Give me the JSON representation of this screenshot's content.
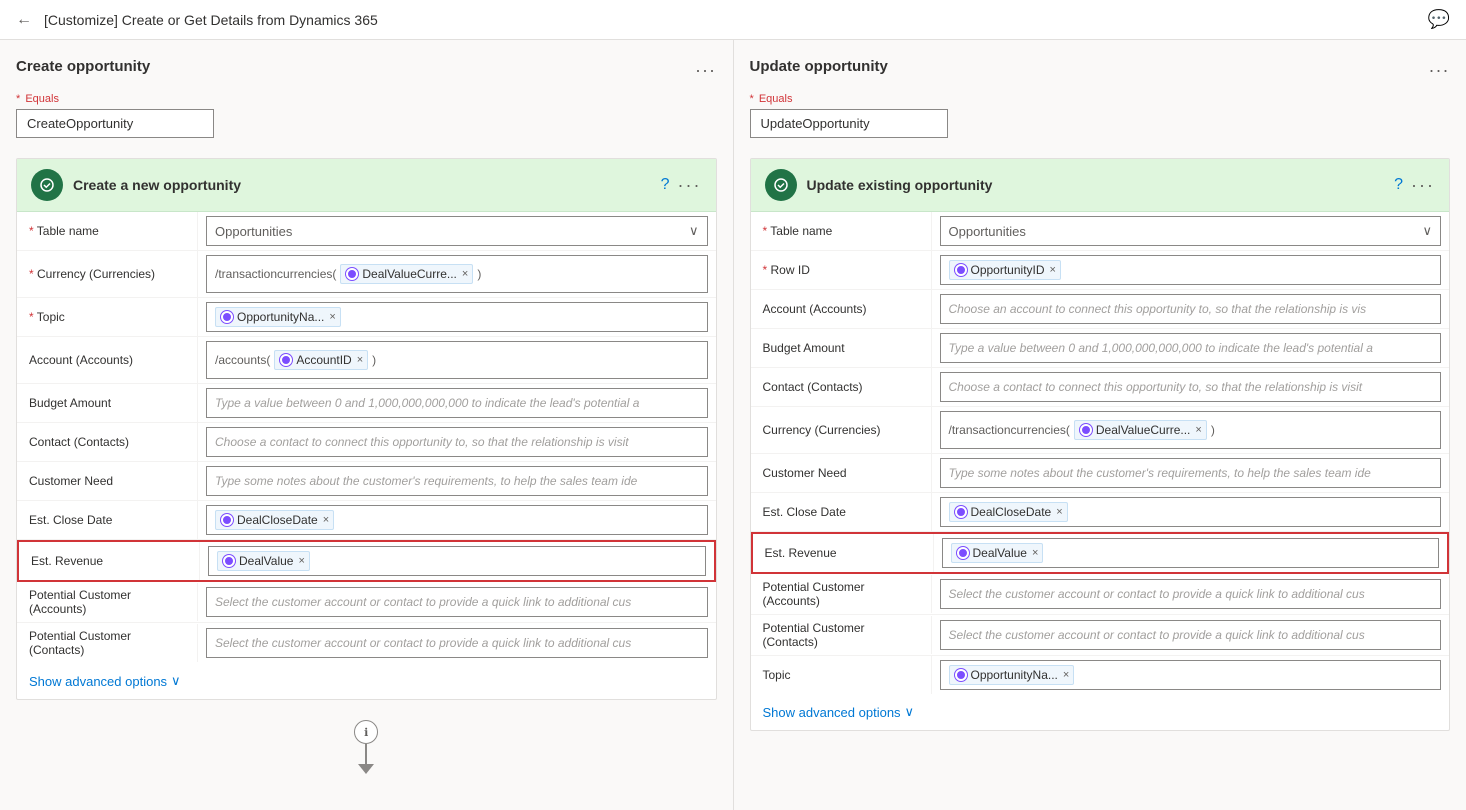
{
  "topbar": {
    "back_icon": "←",
    "title": "[Customize] Create or Get Details from Dynamics 365",
    "chat_icon": "💬"
  },
  "left_panel": {
    "header": {
      "title": "Create opportunity",
      "menu": "..."
    },
    "equals": {
      "label": "Equals",
      "required": true,
      "value": "CreateOpportunity"
    },
    "action_card": {
      "title": "Create a new opportunity",
      "help_icon": "?",
      "more_icon": "..."
    },
    "fields": [
      {
        "label": "Table name",
        "required": true,
        "type": "dropdown",
        "value": "Opportunities"
      },
      {
        "label": "Currency (Currencies)",
        "required": true,
        "type": "mixed",
        "prefix": "/transactioncurrencies(",
        "token": "DealValueCurre...",
        "suffix": ")"
      },
      {
        "label": "Topic",
        "required": true,
        "type": "token",
        "token": "OpportunityNa..."
      },
      {
        "label": "Account (Accounts)",
        "required": false,
        "type": "mixed",
        "prefix": "/accounts(",
        "token": "AccountID",
        "suffix": ")"
      },
      {
        "label": "Budget Amount",
        "required": false,
        "type": "placeholder",
        "placeholder": "Type a value between 0 and 1,000,000,000,000 to indicate the lead's potential a"
      },
      {
        "label": "Contact (Contacts)",
        "required": false,
        "type": "placeholder",
        "placeholder": "Choose a contact to connect this opportunity to, so that the relationship is visit"
      },
      {
        "label": "Customer Need",
        "required": false,
        "type": "placeholder",
        "placeholder": "Type some notes about the customer's requirements, to help the sales team ide"
      },
      {
        "label": "Est. Close Date",
        "required": false,
        "type": "token",
        "token": "DealCloseDate"
      },
      {
        "label": "Est. Revenue",
        "required": false,
        "type": "token",
        "token": "DealValue",
        "highlighted": true
      },
      {
        "label": "Potential Customer (Accounts)",
        "required": false,
        "type": "placeholder",
        "placeholder": "Select the customer account or contact to provide a quick link to additional cus"
      },
      {
        "label": "Potential Customer (Contacts)",
        "required": false,
        "type": "placeholder",
        "placeholder": "Select the customer account or contact to provide a quick link to additional cus"
      }
    ],
    "advanced_options": "Show advanced options",
    "advanced_chevron": "∨"
  },
  "right_panel": {
    "header": {
      "title": "Update opportunity",
      "menu": "..."
    },
    "equals": {
      "label": "Equals",
      "required": true,
      "value": "UpdateOpportunity"
    },
    "action_card": {
      "title": "Update existing opportunity",
      "help_icon": "?",
      "more_icon": "..."
    },
    "fields": [
      {
        "label": "Table name",
        "required": true,
        "type": "dropdown",
        "value": "Opportunities"
      },
      {
        "label": "Row ID",
        "required": true,
        "type": "token",
        "token": "OpportunityID"
      },
      {
        "label": "Account (Accounts)",
        "required": false,
        "type": "placeholder",
        "placeholder": "Choose an account to connect this opportunity to, so that the relationship is vis"
      },
      {
        "label": "Budget Amount",
        "required": false,
        "type": "placeholder",
        "placeholder": "Type a value between 0 and 1,000,000,000,000 to indicate the lead's potential a"
      },
      {
        "label": "Contact (Contacts)",
        "required": false,
        "type": "placeholder",
        "placeholder": "Choose a contact to connect this opportunity to, so that the relationship is visit"
      },
      {
        "label": "Currency (Currencies)",
        "required": false,
        "type": "mixed",
        "prefix": "/transactioncurrencies(",
        "token": "DealValueCurre...",
        "suffix": ")"
      },
      {
        "label": "Customer Need",
        "required": false,
        "type": "placeholder",
        "placeholder": "Type some notes about the customer's requirements, to help the sales team ide"
      },
      {
        "label": "Est. Close Date",
        "required": false,
        "type": "token",
        "token": "DealCloseDate"
      },
      {
        "label": "Est. Revenue",
        "required": false,
        "type": "token",
        "token": "DealValue",
        "highlighted": true
      },
      {
        "label": "Potential Customer (Accounts)",
        "required": false,
        "type": "placeholder",
        "placeholder": "Select the customer account or contact to provide a quick link to additional cus"
      },
      {
        "label": "Potential Customer (Contacts)",
        "required": false,
        "type": "placeholder",
        "placeholder": "Select the customer account or contact to provide a quick link to additional cus"
      },
      {
        "label": "Topic",
        "required": false,
        "type": "token",
        "token": "OpportunityNa..."
      }
    ],
    "advanced_options": "Show advanced options",
    "advanced_chevron": "∨"
  },
  "flow": {
    "info_icon": "ℹ",
    "arrow_icon": "↓"
  }
}
